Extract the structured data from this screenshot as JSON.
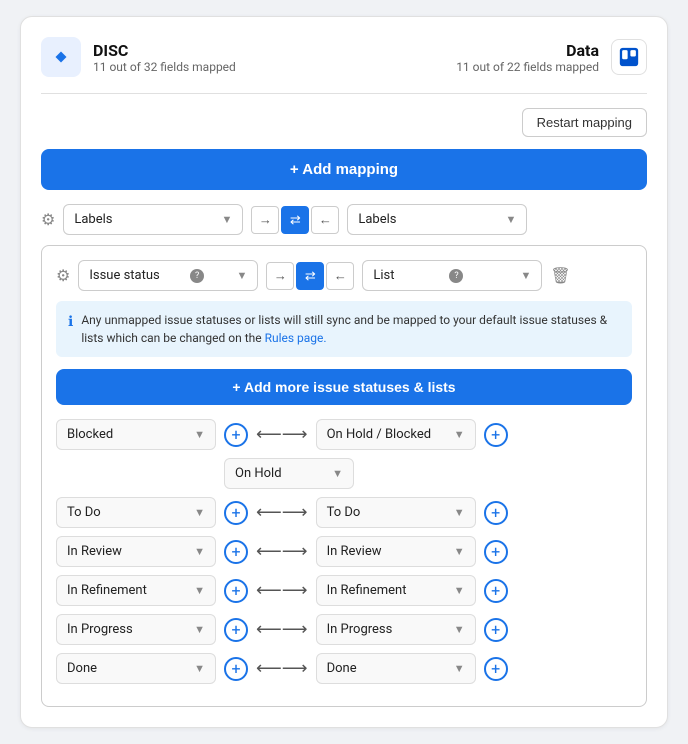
{
  "card": {
    "source": {
      "name": "DISC",
      "fields_mapped": "11 out of 32 fields mapped"
    },
    "destination": {
      "name": "Data",
      "fields_mapped": "11 out of 22 fields mapped"
    },
    "restart_btn": "Restart mapping",
    "add_mapping_btn": "+ Add mapping",
    "labels_row": {
      "source_label": "Labels",
      "dest_label": "Labels"
    },
    "issue_status_row": {
      "source_label": "Issue status",
      "dest_label": "List"
    },
    "info_box": {
      "text_before": "Any unmapped issue statuses or lists will still sync and be mapped to your default issue statuses & lists which can be changed on the ",
      "link_text": "Rules page.",
      "text_after": ""
    },
    "add_statuses_btn": "+ Add more issue statuses & lists",
    "status_mappings": [
      {
        "source_statuses": [
          "Blocked",
          "On Hold"
        ],
        "dest_status": "On Hold / Blocked",
        "grouped": true
      },
      {
        "source_statuses": [
          "To Do"
        ],
        "dest_status": "To Do",
        "grouped": false
      },
      {
        "source_statuses": [
          "In Review"
        ],
        "dest_status": "In Review",
        "grouped": false
      },
      {
        "source_statuses": [
          "In Refinement"
        ],
        "dest_status": "In Refinement",
        "grouped": false
      },
      {
        "source_statuses": [
          "In Progress"
        ],
        "dest_status": "In Progress",
        "grouped": false
      },
      {
        "source_statuses": [
          "Done"
        ],
        "dest_status": "Done",
        "grouped": false
      }
    ]
  }
}
